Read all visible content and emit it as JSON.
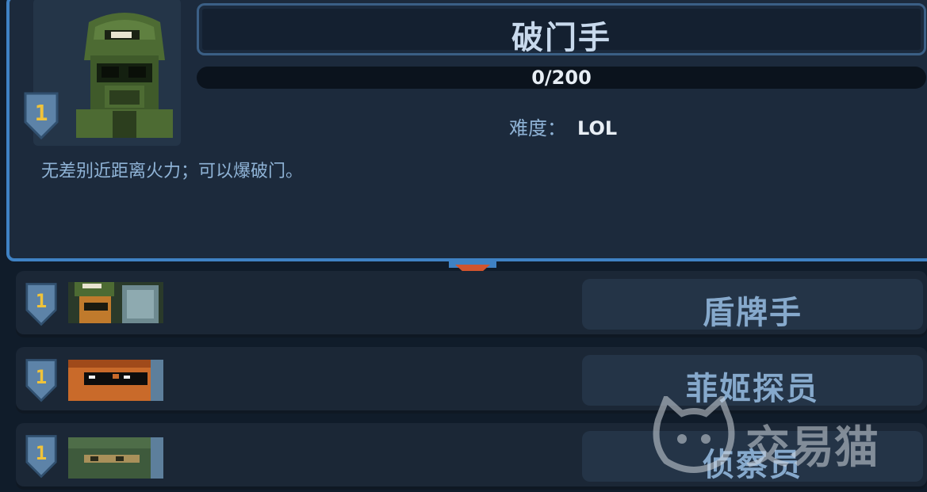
{
  "selected": {
    "level": "1",
    "name": "破门手",
    "progress_text": "0/200",
    "progress_fraction": 0,
    "difficulty_label": "难度：",
    "difficulty_value": "LOL",
    "description": "无差别近距离火力；可以爆破门。",
    "portrait_icon": "soldier-helmet-goggles-icon"
  },
  "list": [
    {
      "level": "1",
      "name": "盾牌手",
      "icon": "shield-soldier-icon"
    },
    {
      "level": "1",
      "name": "菲姬探员",
      "icon": "agent-sunglasses-icon"
    },
    {
      "level": "1",
      "name": "侦察员",
      "icon": "scout-hood-icon"
    }
  ],
  "watermark": {
    "text": "交易猫",
    "icon": "cat-logo-icon"
  },
  "colors": {
    "accent": "#3f82c4",
    "level": "#f0c33a",
    "pointer": "#d2552e",
    "text": "#86a9cc"
  }
}
